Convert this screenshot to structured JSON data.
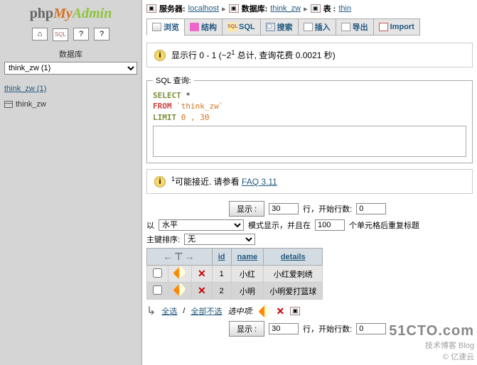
{
  "sidebar": {
    "logo_parts": [
      "php",
      "My",
      "Admin"
    ],
    "icons": [
      "home-icon",
      "sql-icon",
      "docs-icon",
      "query-icon"
    ],
    "db_label": "数据库",
    "db_selected": "think_zw (1)",
    "db_link": "think_zw (1)",
    "table_link": "think_zw"
  },
  "breadcrumb": {
    "server_label": "服务器:",
    "server_value": "localhost",
    "db_label": "数据库:",
    "db_value": "think_zw",
    "table_label": "表 :",
    "table_value": "thin"
  },
  "tabs": [
    {
      "icon": "browse",
      "label": "浏览",
      "active": true
    },
    {
      "icon": "struct",
      "label": "结构"
    },
    {
      "icon": "sql",
      "label": "SQL"
    },
    {
      "icon": "search",
      "label": "搜索"
    },
    {
      "icon": "insert",
      "label": "插入"
    },
    {
      "icon": "export",
      "label": "导出"
    },
    {
      "icon": "import",
      "label": "Import"
    }
  ],
  "notice1": {
    "prefix": "显示行 0 - 1 (~2",
    "sup": "1",
    "suffix": " 总计, 查询花费 0.0021 秒)"
  },
  "sql_query": {
    "legend": "SQL 查询:",
    "select": "SELECT",
    "star": "*",
    "from": "FROM",
    "table": "`think_zw`",
    "limit": "LIMIT",
    "limit_vals": "0 , 30"
  },
  "notice2": {
    "sup": "1",
    "text": "可能接近. 请参看 ",
    "link": "FAQ 3.11"
  },
  "nav": {
    "show_btn": "显示 :",
    "rows_value": "30",
    "rows_label": "行，开始行数:",
    "start_value": "0",
    "mode_prefix": "以",
    "mode_value": "水平",
    "mode_suffix": "模式显示，并且在",
    "repeat_value": "100",
    "repeat_suffix": "个单元格后重复标题",
    "sort_label": "主键排序:",
    "sort_value": "无"
  },
  "table": {
    "headers": [
      "id",
      "name",
      "details"
    ],
    "rows": [
      {
        "id": "1",
        "name": "小红",
        "details": "小红爱刺绣"
      },
      {
        "id": "2",
        "name": "小明",
        "details": "小明爱打篮球"
      }
    ]
  },
  "selection": {
    "all": "全选",
    "none": "全部不选",
    "with_selected": "选中项:"
  },
  "watermark": {
    "line1": "51CTO.com",
    "line2": "技术博客  Blog",
    "line3": "© 亿速云"
  }
}
